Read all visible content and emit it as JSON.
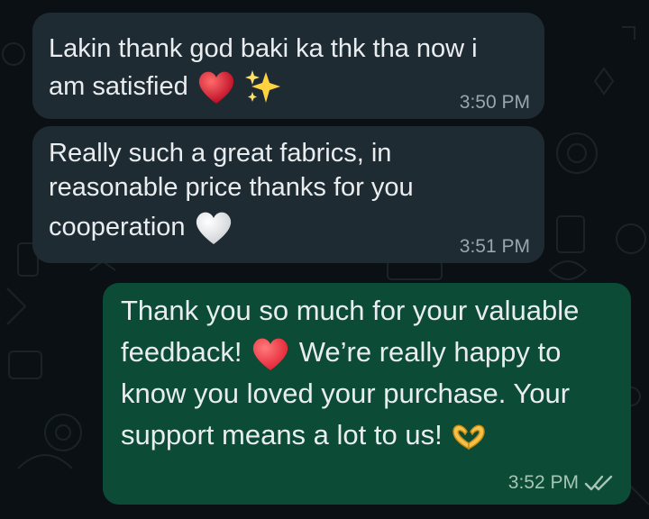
{
  "messages": [
    {
      "direction": "incoming",
      "lines": [
        "Lakin thank god baki ka thk tha now i",
        "am satisfied"
      ],
      "emojis": [
        "red-heart",
        "sparkles"
      ],
      "time": "3:50 PM"
    },
    {
      "direction": "incoming",
      "lines": [
        "Really such a great fabrics, in",
        "reasonable price thanks for you",
        "cooperation"
      ],
      "emojis": [
        "white-heart"
      ],
      "time": "3:51 PM"
    },
    {
      "direction": "outgoing",
      "lines": [
        "Thank you so much for your valuable",
        "feedback!",
        "We’re really happy to",
        "know you loved your purchase. Your",
        "support means a lot to us!"
      ],
      "emojis": [
        "red-heart",
        "heart-hands"
      ],
      "time": "3:52 PM",
      "status": "read-double-check"
    }
  ],
  "colors": {
    "background": "#0b1014",
    "incoming_bubble": "#1f2b33",
    "outgoing_bubble": "#0c4b35",
    "text": "#e9edef"
  }
}
